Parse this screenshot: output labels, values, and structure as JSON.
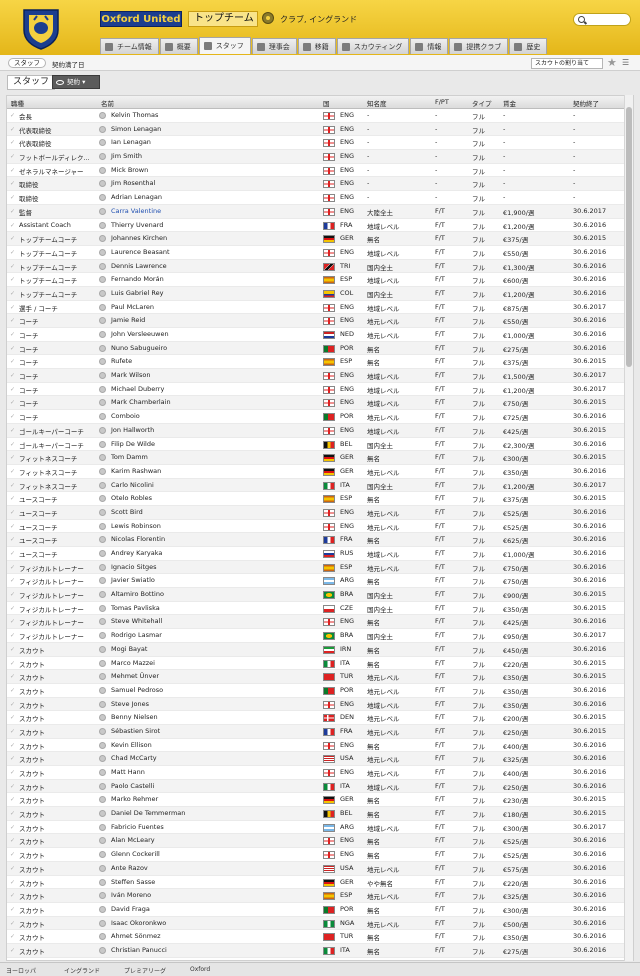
{
  "header": {
    "club_name": "Oxford United",
    "team_selector": "トップチーム",
    "subtitle": "クラブ, イングランド"
  },
  "tabs": [
    {
      "label": "チーム情報",
      "icon": "squad-icon"
    },
    {
      "label": "概要",
      "icon": "overview-icon"
    },
    {
      "label": "スタッフ",
      "icon": "person-icon"
    },
    {
      "label": "理事会",
      "icon": "board-icon"
    },
    {
      "label": "移籍",
      "icon": "transfer-icon"
    },
    {
      "label": "スカウティング",
      "icon": "scouting-icon"
    },
    {
      "label": "情報",
      "icon": "info-icon"
    },
    {
      "label": "提携クラブ",
      "icon": "affiliate-icon"
    },
    {
      "label": "歴史",
      "icon": "history-icon"
    }
  ],
  "subbar": {
    "crumb": "スタッフ",
    "crumb2": "契約満了日",
    "sort": "スカウトの割り当て"
  },
  "section": {
    "title": "スタッフ",
    "view": "契約"
  },
  "columns": {
    "role": "職種",
    "name": "名前",
    "nation": "国",
    "reputation": "知名度",
    "fp": "F/PT",
    "type": "タイプ",
    "wage": "賃金",
    "expiry": "契約終了"
  },
  "rows": [
    {
      "role": "会長",
      "name": "Kelvin Thomas",
      "nat": "ENG",
      "rep": "-",
      "fp": "-",
      "typ": "フル",
      "wage": "-",
      "exp": "-"
    },
    {
      "role": "代表取締役",
      "name": "Simon Lenagan",
      "nat": "ENG",
      "rep": "-",
      "fp": "-",
      "typ": "フル",
      "wage": "-",
      "exp": "-"
    },
    {
      "role": "代表取締役",
      "name": "Ian Lenagan",
      "nat": "ENG",
      "rep": "-",
      "fp": "-",
      "typ": "フル",
      "wage": "-",
      "exp": "-"
    },
    {
      "role": "フットボールディレク...",
      "name": "Jim Smith",
      "nat": "ENG",
      "rep": "-",
      "fp": "-",
      "typ": "フル",
      "wage": "-",
      "exp": "-"
    },
    {
      "role": "ゼネラルマネージャー",
      "name": "Mick Brown",
      "nat": "ENG",
      "rep": "-",
      "fp": "-",
      "typ": "フル",
      "wage": "-",
      "exp": "-"
    },
    {
      "role": "取締役",
      "name": "Jim Rosenthal",
      "nat": "ENG",
      "rep": "-",
      "fp": "-",
      "typ": "フル",
      "wage": "-",
      "exp": "-"
    },
    {
      "role": "取締役",
      "name": "Adrian Lenagan",
      "nat": "ENG",
      "rep": "-",
      "fp": "-",
      "typ": "フル",
      "wage": "-",
      "exp": "-"
    },
    {
      "role": "監督",
      "name": "Carra Valentine",
      "nat": "ENG",
      "rep": "大陸全土",
      "fp": "F/T",
      "typ": "フル",
      "wage": "€1,900/週",
      "exp": "30.6.2017",
      "link": true
    },
    {
      "role": "Assistant Coach",
      "name": "Thierry Uvenard",
      "nat": "FRA",
      "rep": "地域レベル",
      "fp": "F/T",
      "typ": "フル",
      "wage": "€1,200/週",
      "exp": "30.6.2016"
    },
    {
      "role": "トップチームコーチ",
      "name": "Johannes Kirchen",
      "nat": "GER",
      "rep": "無名",
      "fp": "F/T",
      "typ": "フル",
      "wage": "€375/週",
      "exp": "30.6.2015"
    },
    {
      "role": "トップチームコーチ",
      "name": "Laurence Beasant",
      "nat": "ENG",
      "rep": "地域レベル",
      "fp": "F/T",
      "typ": "フル",
      "wage": "€550/週",
      "exp": "30.6.2016"
    },
    {
      "role": "トップチームコーチ",
      "name": "Dennis Lawrence",
      "nat": "TRI",
      "rep": "国内全土",
      "fp": "F/T",
      "typ": "フル",
      "wage": "€1,300/週",
      "exp": "30.6.2016"
    },
    {
      "role": "トップチームコーチ",
      "name": "Fernando Morán",
      "nat": "ESP",
      "rep": "地域レベル",
      "fp": "F/T",
      "typ": "フル",
      "wage": "€600/週",
      "exp": "30.6.2016"
    },
    {
      "role": "トップチームコーチ",
      "name": "Luis Gabriel Rey",
      "nat": "COL",
      "rep": "国内全土",
      "fp": "F/T",
      "typ": "フル",
      "wage": "€1,200/週",
      "exp": "30.6.2016"
    },
    {
      "role": "選手 / コーチ",
      "name": "Paul McLaren",
      "nat": "ENG",
      "rep": "地域レベル",
      "fp": "F/T",
      "typ": "フル",
      "wage": "€875/週",
      "exp": "30.6.2017"
    },
    {
      "role": "コーチ",
      "name": "Jamie Reid",
      "nat": "ENG",
      "rep": "地元レベル",
      "fp": "F/T",
      "typ": "フル",
      "wage": "€550/週",
      "exp": "30.6.2016"
    },
    {
      "role": "コーチ",
      "name": "John Versleeuwen",
      "nat": "NED",
      "rep": "地元レベル",
      "fp": "F/T",
      "typ": "フル",
      "wage": "€1,000/週",
      "exp": "30.6.2016"
    },
    {
      "role": "コーチ",
      "name": "Nuno Sabugueiro",
      "nat": "POR",
      "rep": "無名",
      "fp": "F/T",
      "typ": "フル",
      "wage": "€275/週",
      "exp": "30.6.2016"
    },
    {
      "role": "コーチ",
      "name": "Rufete",
      "nat": "ESP",
      "rep": "無名",
      "fp": "F/T",
      "typ": "フル",
      "wage": "€375/週",
      "exp": "30.6.2015"
    },
    {
      "role": "コーチ",
      "name": "Mark Wilson",
      "nat": "ENG",
      "rep": "地域レベル",
      "fp": "F/T",
      "typ": "フル",
      "wage": "€1,500/週",
      "exp": "30.6.2017"
    },
    {
      "role": "コーチ",
      "name": "Michael Duberry",
      "nat": "ENG",
      "rep": "地域レベル",
      "fp": "F/T",
      "typ": "フル",
      "wage": "€1,200/週",
      "exp": "30.6.2017"
    },
    {
      "role": "コーチ",
      "name": "Mark Chamberlain",
      "nat": "ENG",
      "rep": "地域レベル",
      "fp": "F/T",
      "typ": "フル",
      "wage": "€750/週",
      "exp": "30.6.2015"
    },
    {
      "role": "コーチ",
      "name": "Comboio",
      "nat": "POR",
      "rep": "地元レベル",
      "fp": "F/T",
      "typ": "フル",
      "wage": "€725/週",
      "exp": "30.6.2016"
    },
    {
      "role": "ゴールキーパーコーチ",
      "name": "Jon Hallworth",
      "nat": "ENG",
      "rep": "地域レベル",
      "fp": "F/T",
      "typ": "フル",
      "wage": "€425/週",
      "exp": "30.6.2015"
    },
    {
      "role": "ゴールキーパーコーチ",
      "name": "Filip De Wilde",
      "nat": "BEL",
      "rep": "国内全土",
      "fp": "F/T",
      "typ": "フル",
      "wage": "€2,300/週",
      "exp": "30.6.2016"
    },
    {
      "role": "フィットネスコーチ",
      "name": "Tom Damm",
      "nat": "GER",
      "rep": "無名",
      "fp": "F/T",
      "typ": "フル",
      "wage": "€300/週",
      "exp": "30.6.2015"
    },
    {
      "role": "フィットネスコーチ",
      "name": "Karim Rashwan",
      "nat": "GER",
      "rep": "地元レベル",
      "fp": "F/T",
      "typ": "フル",
      "wage": "€350/週",
      "exp": "30.6.2016"
    },
    {
      "role": "フィットネスコーチ",
      "name": "Carlo Nicolini",
      "nat": "ITA",
      "rep": "国内全土",
      "fp": "F/T",
      "typ": "フル",
      "wage": "€1,200/週",
      "exp": "30.6.2017"
    },
    {
      "role": "ユースコーチ",
      "name": "Otelo Robles",
      "nat": "ESP",
      "rep": "無名",
      "fp": "F/T",
      "typ": "フル",
      "wage": "€375/週",
      "exp": "30.6.2015"
    },
    {
      "role": "ユースコーチ",
      "name": "Scott Bird",
      "nat": "ENG",
      "rep": "地元レベル",
      "fp": "F/T",
      "typ": "フル",
      "wage": "€525/週",
      "exp": "30.6.2016"
    },
    {
      "role": "ユースコーチ",
      "name": "Lewis Robinson",
      "nat": "ENG",
      "rep": "地元レベル",
      "fp": "F/T",
      "typ": "フル",
      "wage": "€525/週",
      "exp": "30.6.2016"
    },
    {
      "role": "ユースコーチ",
      "name": "Nicolas Florentin",
      "nat": "FRA",
      "rep": "無名",
      "fp": "F/T",
      "typ": "フル",
      "wage": "€625/週",
      "exp": "30.6.2016"
    },
    {
      "role": "ユースコーチ",
      "name": "Andrey Karyaka",
      "nat": "RUS",
      "rep": "地域レベル",
      "fp": "F/T",
      "typ": "フル",
      "wage": "€1,000/週",
      "exp": "30.6.2016"
    },
    {
      "role": "フィジカルトレーナー",
      "name": "Ignacio Sitges",
      "nat": "ESP",
      "rep": "地元レベル",
      "fp": "F/T",
      "typ": "フル",
      "wage": "€750/週",
      "exp": "30.6.2016"
    },
    {
      "role": "フィジカルトレーナー",
      "name": "Javier Swiatlo",
      "nat": "ARG",
      "rep": "無名",
      "fp": "F/T",
      "typ": "フル",
      "wage": "€750/週",
      "exp": "30.6.2016"
    },
    {
      "role": "フィジカルトレーナー",
      "name": "Altamiro Bottino",
      "nat": "BRA",
      "rep": "国内全土",
      "fp": "F/T",
      "typ": "フル",
      "wage": "€900/週",
      "exp": "30.6.2015"
    },
    {
      "role": "フィジカルトレーナー",
      "name": "Tomas Pavliska",
      "nat": "CZE",
      "rep": "国内全土",
      "fp": "F/T",
      "typ": "フル",
      "wage": "€350/週",
      "exp": "30.6.2015"
    },
    {
      "role": "フィジカルトレーナー",
      "name": "Steve Whitehall",
      "nat": "ENG",
      "rep": "無名",
      "fp": "F/T",
      "typ": "フル",
      "wage": "€425/週",
      "exp": "30.6.2016"
    },
    {
      "role": "フィジカルトレーナー",
      "name": "Rodrigo Lasmar",
      "nat": "BRA",
      "rep": "国内全土",
      "fp": "F/T",
      "typ": "フル",
      "wage": "€950/週",
      "exp": "30.6.2017"
    },
    {
      "role": "スカウト",
      "name": "Mogi Bayat",
      "nat": "IRN",
      "rep": "無名",
      "fp": "F/T",
      "typ": "フル",
      "wage": "€450/週",
      "exp": "30.6.2016"
    },
    {
      "role": "スカウト",
      "name": "Marco Mazzei",
      "nat": "ITA",
      "rep": "無名",
      "fp": "F/T",
      "typ": "フル",
      "wage": "€220/週",
      "exp": "30.6.2015"
    },
    {
      "role": "スカウト",
      "name": "Mehmet Ünver",
      "nat": "TUR",
      "rep": "地元レベル",
      "fp": "F/T",
      "typ": "フル",
      "wage": "€350/週",
      "exp": "30.6.2015"
    },
    {
      "role": "スカウト",
      "name": "Samuel Pedroso",
      "nat": "POR",
      "rep": "地元レベル",
      "fp": "F/T",
      "typ": "フル",
      "wage": "€350/週",
      "exp": "30.6.2016"
    },
    {
      "role": "スカウト",
      "name": "Steve Jones",
      "nat": "ENG",
      "rep": "地域レベル",
      "fp": "F/T",
      "typ": "フル",
      "wage": "€350/週",
      "exp": "30.6.2016"
    },
    {
      "role": "スカウト",
      "name": "Benny Nielsen",
      "nat": "DEN",
      "rep": "地元レベル",
      "fp": "F/T",
      "typ": "フル",
      "wage": "€200/週",
      "exp": "30.6.2015"
    },
    {
      "role": "スカウト",
      "name": "Sébastien Sirot",
      "nat": "FRA",
      "rep": "地元レベル",
      "fp": "F/T",
      "typ": "フル",
      "wage": "€250/週",
      "exp": "30.6.2015"
    },
    {
      "role": "スカウト",
      "name": "Kevin Ellison",
      "nat": "ENG",
      "rep": "無名",
      "fp": "F/T",
      "typ": "フル",
      "wage": "€400/週",
      "exp": "30.6.2016"
    },
    {
      "role": "スカウト",
      "name": "Chad McCarty",
      "nat": "USA",
      "rep": "地元レベル",
      "fp": "F/T",
      "typ": "フル",
      "wage": "€325/週",
      "exp": "30.6.2016"
    },
    {
      "role": "スカウト",
      "name": "Matt Hann",
      "nat": "ENG",
      "rep": "地元レベル",
      "fp": "F/T",
      "typ": "フル",
      "wage": "€400/週",
      "exp": "30.6.2016"
    },
    {
      "role": "スカウト",
      "name": "Paolo Castelli",
      "nat": "ITA",
      "rep": "地域レベル",
      "fp": "F/T",
      "typ": "フル",
      "wage": "€250/週",
      "exp": "30.6.2016"
    },
    {
      "role": "スカウト",
      "name": "Marko Rehmer",
      "nat": "GER",
      "rep": "無名",
      "fp": "F/T",
      "typ": "フル",
      "wage": "€230/週",
      "exp": "30.6.2015"
    },
    {
      "role": "スカウト",
      "name": "Daniel De Temmerman",
      "nat": "BEL",
      "rep": "無名",
      "fp": "F/T",
      "typ": "フル",
      "wage": "€180/週",
      "exp": "30.6.2015"
    },
    {
      "role": "スカウト",
      "name": "Fabricio Fuentes",
      "nat": "ARG",
      "rep": "地域レベル",
      "fp": "F/T",
      "typ": "フル",
      "wage": "€300/週",
      "exp": "30.6.2017"
    },
    {
      "role": "スカウト",
      "name": "Alan McLeary",
      "nat": "ENG",
      "rep": "無名",
      "fp": "F/T",
      "typ": "フル",
      "wage": "€525/週",
      "exp": "30.6.2016"
    },
    {
      "role": "スカウト",
      "name": "Glenn Cockerill",
      "nat": "ENG",
      "rep": "無名",
      "fp": "F/T",
      "typ": "フル",
      "wage": "€525/週",
      "exp": "30.6.2016"
    },
    {
      "role": "スカウト",
      "name": "Ante Razov",
      "nat": "USA",
      "rep": "地元レベル",
      "fp": "F/T",
      "typ": "フル",
      "wage": "€575/週",
      "exp": "30.6.2016"
    },
    {
      "role": "スカウト",
      "name": "Steffen Sasse",
      "nat": "GER",
      "rep": "やや無名",
      "fp": "F/T",
      "typ": "フル",
      "wage": "€220/週",
      "exp": "30.6.2016"
    },
    {
      "role": "スカウト",
      "name": "Iván Moreno",
      "nat": "ESP",
      "rep": "地元レベル",
      "fp": "F/T",
      "typ": "フル",
      "wage": "€325/週",
      "exp": "30.6.2016"
    },
    {
      "role": "スカウト",
      "name": "David Fraga",
      "nat": "POR",
      "rep": "無名",
      "fp": "F/T",
      "typ": "フル",
      "wage": "€300/週",
      "exp": "30.6.2016"
    },
    {
      "role": "スカウト",
      "name": "Isaac Okoronkwo",
      "nat": "NGA",
      "rep": "地元レベル",
      "fp": "F/T",
      "typ": "フル",
      "wage": "€500/週",
      "exp": "30.6.2016"
    },
    {
      "role": "スカウト",
      "name": "Ahmet Sönmez",
      "nat": "TUR",
      "rep": "無名",
      "fp": "F/T",
      "typ": "フル",
      "wage": "€350/週",
      "exp": "30.6.2016"
    },
    {
      "role": "スカウト",
      "name": "Christian Panucci",
      "nat": "ITA",
      "rep": "無名",
      "fp": "F/T",
      "typ": "フル",
      "wage": "€275/週",
      "exp": "30.6.2016"
    }
  ],
  "footer": [
    "ヨーロッパ",
    "イングランド",
    "プレミアリーグ",
    "Oxford"
  ],
  "colors": {
    "header_yellow": "#f2cc34",
    "club_blue": "#1c3e8f",
    "link_blue": "#1f4fb0"
  }
}
